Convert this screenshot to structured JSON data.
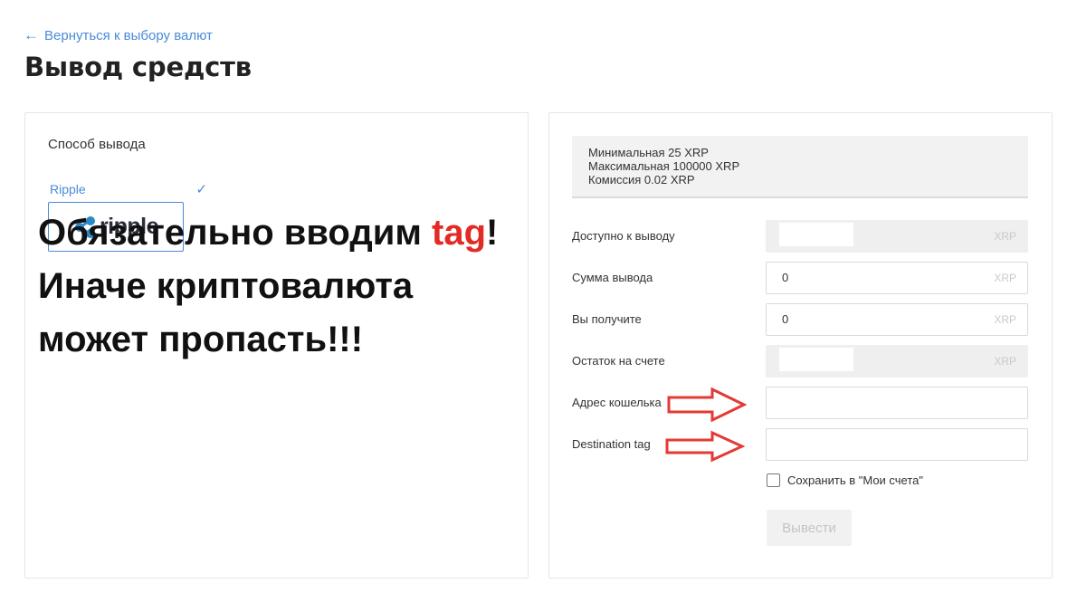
{
  "back_link": {
    "icon": "arrow-left-icon",
    "label": "Вернуться к выбору валют"
  },
  "page_title": "Вывод средств",
  "method_panel": {
    "heading": "Способ вывода",
    "selected_method": {
      "name": "Ripple",
      "logo_text": "ripple",
      "icon": "check-icon"
    }
  },
  "warning": {
    "line1_prefix": "Обязательно вводим ",
    "line1_accent": "tag",
    "line1_suffix": "!",
    "line2": "Иначе криптовалюта",
    "line3": "может пропасть!!!"
  },
  "limits": {
    "min": "Минимальная 25 XRP",
    "max": "Максимальная 100000 XRP",
    "fee": "Комиссия 0.02 XRP"
  },
  "form": {
    "available_label": "Доступно к выводу",
    "available_unit": "XRP",
    "amount_label": "Сумма вывода",
    "amount_value": "0",
    "amount_unit": "XRP",
    "receive_label": "Вы получите",
    "receive_value": "0",
    "receive_unit": "XRP",
    "balance_label": "Остаток на счете",
    "balance_unit": "XRP",
    "address_label": "Адрес кошелька",
    "address_value": "",
    "tag_label": "Destination tag",
    "tag_value": "",
    "save_label": "Сохранить в \"Мои счета\"",
    "save_checked": false,
    "submit_label": "Вывести"
  },
  "colors": {
    "link": "#4a8bd8",
    "accent_red": "#e22b26",
    "arrow_red": "#e53935"
  }
}
